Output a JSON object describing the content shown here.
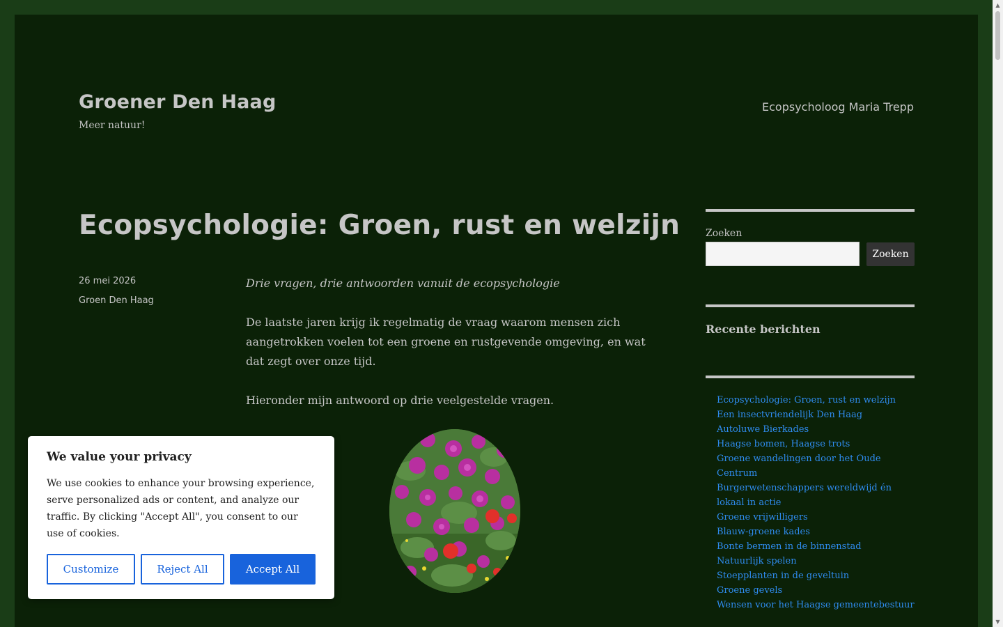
{
  "header": {
    "site_title": "Groener Den Haag",
    "tagline": "Meer natuur!",
    "nav_link": "Ecopsycholoog Maria Trepp"
  },
  "post": {
    "title": "Ecopsychologie: Groen, rust en welzijn",
    "date": "26 mei 2026",
    "category": "Groen Den Haag",
    "paragraphs": [
      "Drie vragen, drie antwoorden vanuit de ecopsychologie",
      "De laatste jaren krijg ik regelmatig de vraag waarom mensen zich aangetrokken voelen tot een groene en rustgevende omgeving, en wat dat zegt over onze tijd.",
      "Hieronder mijn antwoord op drie veelgestelde vragen."
    ]
  },
  "sidebar": {
    "search_label": "Zoeken",
    "search_value": "",
    "search_button": "Zoeken",
    "recent_title": "Recente berichten",
    "recent_posts": [
      "Ecopsychologie: Groen, rust en welzijn",
      "Een insectvriendelijk Den Haag",
      "Autoluwe Bierkades",
      "Haagse bomen, Haagse trots",
      "Groene wandelingen door het Oude Centrum",
      "Burgerwetenschappers wereldwijd én lokaal in actie",
      "Groene vrijwilligers",
      "Blauw-groene kades",
      "Bonte bermen in de binnenstad",
      "Natuurlijk spelen",
      "Stoepplanten in de geveltuin",
      "Groene gevels",
      "Wensen voor het Haagse gemeentebestuur"
    ]
  },
  "cookie_banner": {
    "title": "We value your privacy",
    "text": "We use cookies to enhance your browsing experience, serve personalized ads or content, and analyze our traffic. By clicking \"Accept All\", you consent to our use of cookies.",
    "customize_label": "Customize",
    "reject_label": "Reject All",
    "accept_label": "Accept All"
  },
  "colors": {
    "outer_background": "#1a3d17",
    "page_background": "#0b2107",
    "text": "#c6c6c6",
    "link": "#2f8cf0",
    "cookie_accent": "#1863dc"
  }
}
